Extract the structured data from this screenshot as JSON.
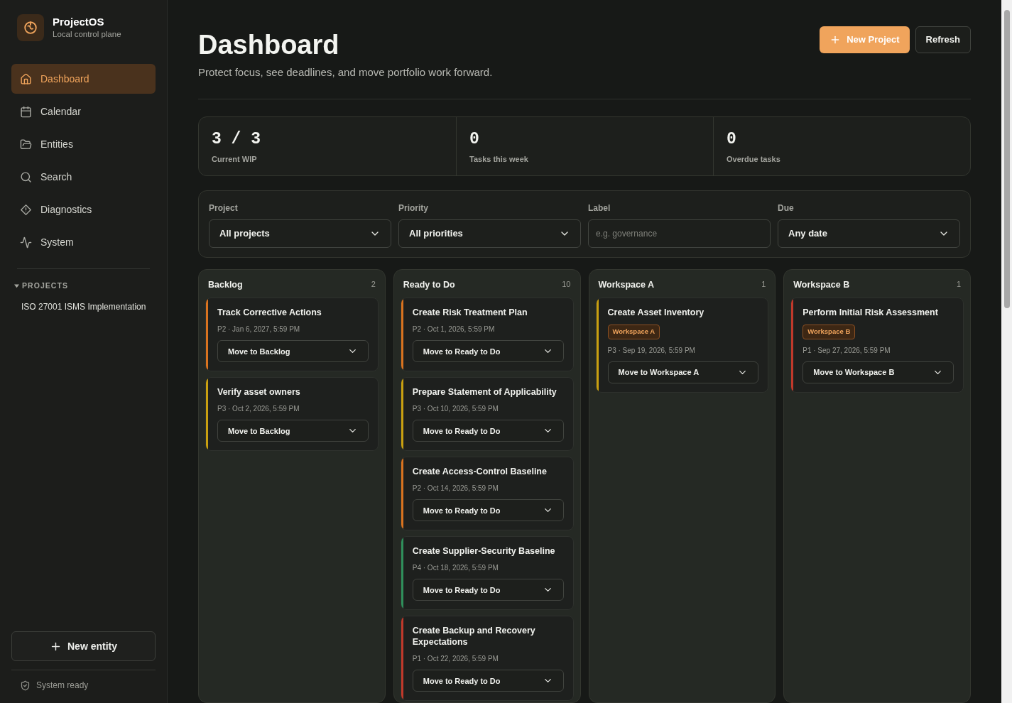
{
  "brand": {
    "name": "ProjectOS",
    "subtitle": "Local control plane"
  },
  "nav": [
    {
      "label": "Dashboard",
      "selected": true
    },
    {
      "label": "Calendar",
      "selected": false
    },
    {
      "label": "Entities",
      "selected": false
    },
    {
      "label": "Search",
      "selected": false
    },
    {
      "label": "Diagnostics",
      "selected": false
    },
    {
      "label": "System",
      "selected": false
    }
  ],
  "projects": {
    "heading": "PROJECTS",
    "expanded": true,
    "items": [
      "ISO 27001 ISMS Implementation"
    ]
  },
  "new_entity_button": "New entity",
  "status": "System ready",
  "header": {
    "title": "Dashboard",
    "subtitle": "Protect focus, see deadlines, and move portfolio work forward.",
    "primary_button": "New Project",
    "secondary_button": "Refresh"
  },
  "stats": [
    {
      "value": "3 / 3",
      "label": "Current WIP"
    },
    {
      "value": "0",
      "label": "Tasks this week"
    },
    {
      "value": "0",
      "label": "Overdue tasks"
    }
  ],
  "filters": [
    {
      "kind": "select",
      "label": "Project",
      "value": "All projects"
    },
    {
      "kind": "select",
      "label": "Priority",
      "value": "All priorities"
    },
    {
      "kind": "input",
      "label": "Label",
      "placeholder": "e.g. governance"
    },
    {
      "kind": "select",
      "label": "Due",
      "value": "Any date"
    }
  ],
  "columns": [
    {
      "title": "Backlog",
      "count": "2",
      "cards": [
        {
          "title": "Track Corrective Actions",
          "meta": "P2 · Jan 6, 2027, 5:59 PM",
          "move": "Move to Backlog",
          "color": "#d9731f"
        },
        {
          "title": "Verify asset owners",
          "meta": "P3 · Oct 2, 2026, 5:59 PM",
          "move": "Move to Backlog",
          "color": "#c9a010"
        }
      ]
    },
    {
      "title": "Ready to Do",
      "count": "10",
      "cards": [
        {
          "title": "Create Risk Treatment Plan",
          "meta": "P2 · Oct 1, 2026, 5:59 PM",
          "move": "Move to Ready to Do",
          "color": "#d9731f"
        },
        {
          "title": "Prepare Statement of Applicability",
          "meta": "P3 · Oct 10, 2026, 5:59 PM",
          "move": "Move to Ready to Do",
          "color": "#c9a010"
        },
        {
          "title": "Create Access-Control Baseline",
          "meta": "P2 · Oct 14, 2026, 5:59 PM",
          "move": "Move to Ready to Do",
          "color": "#d9731f"
        },
        {
          "title": "Create Supplier-Security Baseline",
          "meta": "P4 · Oct 18, 2026, 5:59 PM",
          "move": "Move to Ready to Do",
          "color": "#2f8f5b"
        },
        {
          "title": "Create Backup and Recovery Expectations",
          "meta": "P1 · Oct 22, 2026, 5:59 PM",
          "move": "Move to Ready to Do",
          "color": "#c0392b"
        }
      ]
    },
    {
      "title": "Workspace A",
      "count": "1",
      "cards": [
        {
          "title": "Create Asset Inventory",
          "tag": "Workspace A",
          "meta": "P3 · Sep 19, 2026, 5:59 PM",
          "move": "Move to Workspace A",
          "color": "#c9a010"
        }
      ]
    },
    {
      "title": "Workspace B",
      "count": "1",
      "cards": [
        {
          "title": "Perform Initial Risk Assessment",
          "tag": "Workspace B",
          "meta": "P1 · Sep 27, 2026, 5:59 PM",
          "move": "Move to Workspace B",
          "color": "#c0392b"
        }
      ]
    }
  ]
}
